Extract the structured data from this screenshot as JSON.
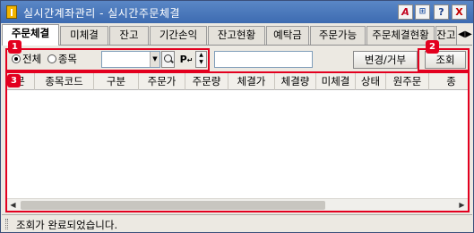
{
  "window": {
    "title": "실시간계좌관리 - 실시간주문체결",
    "buttons": {
      "a_label": "A",
      "pin_label": "⊞",
      "help_label": "?",
      "close_label": "X"
    }
  },
  "tabs": [
    {
      "label": "주문체결",
      "active": true
    },
    {
      "label": "미체결",
      "active": false
    },
    {
      "label": "잔고",
      "active": false
    },
    {
      "label": "기간손익",
      "active": false
    },
    {
      "label": "잔고현황",
      "active": false
    },
    {
      "label": "예탁금",
      "active": false
    },
    {
      "label": "주문가능",
      "active": false
    },
    {
      "label": "주문체결현황",
      "active": false
    },
    {
      "label": "잔고",
      "active": false
    }
  ],
  "badges": {
    "b1": "1",
    "b2": "2",
    "b3": "3"
  },
  "toolbar": {
    "radio_all": "전체",
    "radio_item": "종목",
    "selected_radio": "전체",
    "p_label": "P",
    "change_button": "변경/거부",
    "query_button": "조회"
  },
  "grid": {
    "columns": [
      "문",
      "종목코드",
      "구분",
      "주문가",
      "주문량",
      "체결가",
      "체결량",
      "미체결",
      "상태",
      "원주문",
      "종"
    ]
  },
  "status": {
    "message": "조회가 완료되었습니다."
  },
  "colors": {
    "titlebar": "#3d6bb1",
    "highlight": "#e3001f"
  }
}
